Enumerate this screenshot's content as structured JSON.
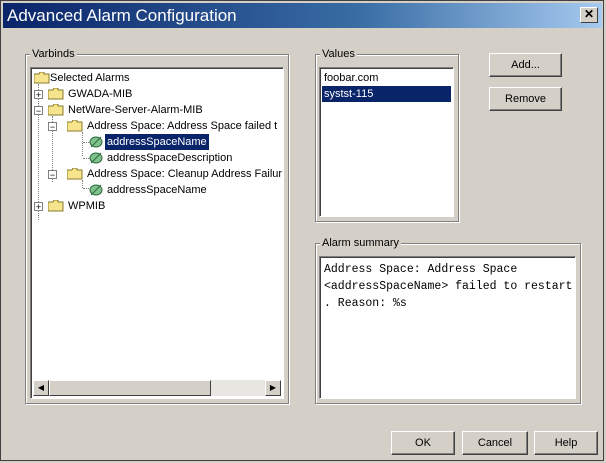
{
  "window": {
    "title": "Advanced Alarm Configuration",
    "close_glyph": "✕"
  },
  "varbinds": {
    "label": "Varbinds",
    "tree": {
      "root": "Selected Alarms",
      "gwada": "GWADA-MIB",
      "netware": "NetWare-Server-Alarm-MIB",
      "alarm1": "Address Space: Address Space failed t",
      "alarm1_child1": "addressSpaceName",
      "alarm1_child2": "addressSpaceDescription",
      "alarm2": "Address Space: Cleanup Address Failur",
      "alarm2_child1": "addressSpaceName",
      "wpmib": "WPMIB"
    }
  },
  "values": {
    "label": "Values",
    "items": [
      "foobar.com",
      "systst-115"
    ]
  },
  "buttons": {
    "add": "Add...",
    "remove": "Remove",
    "ok": "OK",
    "cancel": "Cancel",
    "help": "Help"
  },
  "summary": {
    "label": "Alarm summary",
    "text": "Address Space: Address Space\n<addressSpaceName> failed to restart\n. Reason: %s"
  }
}
